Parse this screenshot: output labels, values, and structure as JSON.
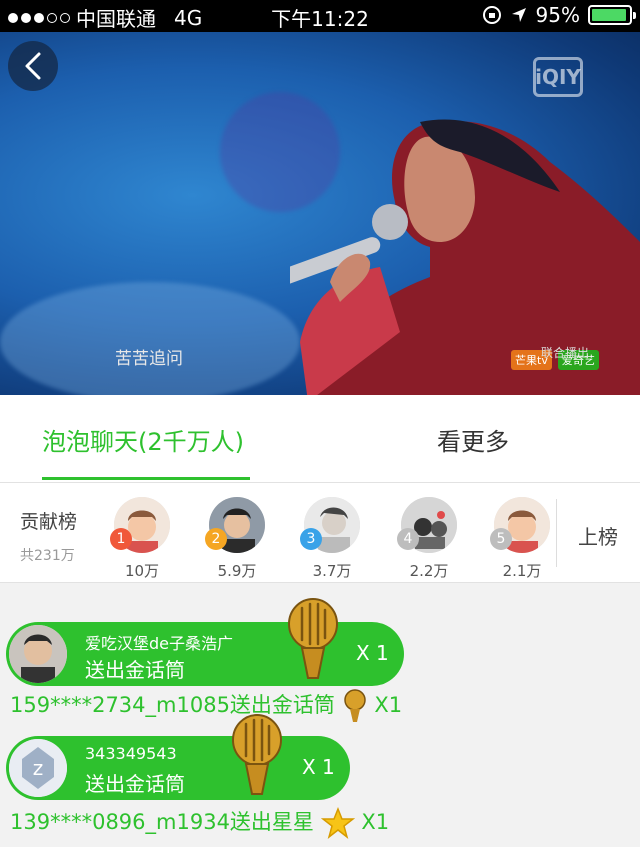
{
  "status_bar": {
    "carrier": "中国联通",
    "network": "4G",
    "time": "下午11:22",
    "battery": "95%",
    "battery_level": 0.95
  },
  "video": {
    "watermark": "iQIY",
    "subtitle": "苦苦追问",
    "broadcast_logo_1": "芒果tv",
    "broadcast_logo_2": "爱奇艺",
    "broadcast_label": "联合播出"
  },
  "tabs": [
    {
      "label": "泡泡聊天(2千万人)",
      "active": true
    },
    {
      "label": "看更多",
      "active": false
    }
  ],
  "contribution": {
    "title": "贡献榜",
    "total": "共231万",
    "action": "上榜",
    "ranks": [
      {
        "rank": "1",
        "amount": "10万",
        "badge_color": "#f0583a"
      },
      {
        "rank": "2",
        "amount": "5.9万",
        "badge_color": "#f5a623"
      },
      {
        "rank": "3",
        "amount": "3.7万",
        "badge_color": "#39a2e8"
      },
      {
        "rank": "4",
        "amount": "2.2万",
        "badge_color": "#bdbdbd"
      },
      {
        "rank": "5",
        "amount": "2.1万",
        "badge_color": "#bdbdbd"
      }
    ]
  },
  "chat": {
    "line_1": "159****2734_m1085送出金话筒",
    "line_1_count": "X1",
    "line_2": "139****0896_m1934送出星星",
    "line_2_count": "X1",
    "gift_1": {
      "user": "爱吃汉堡de子桑浩广",
      "action": "送出金话筒",
      "count": "X 1"
    },
    "gift_2": {
      "user": "343349543",
      "action": "送出金话筒",
      "count": "X 1"
    }
  },
  "colors": {
    "accent": "#2ec12e"
  }
}
